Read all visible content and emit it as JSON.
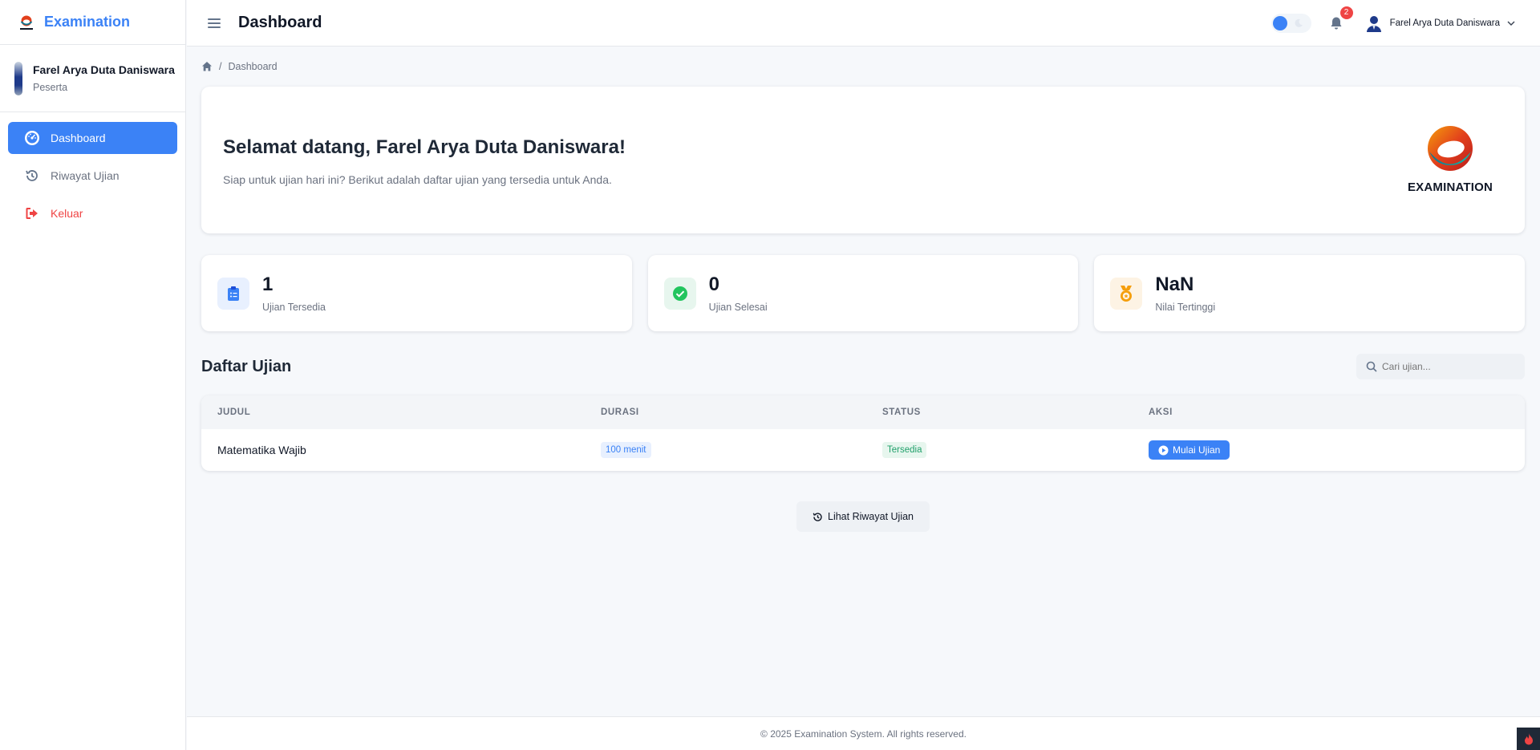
{
  "app": {
    "name": "Examination"
  },
  "user": {
    "name": "Farel Arya Duta Daniswara",
    "role": "Peserta"
  },
  "sidebar": {
    "items": [
      {
        "label": "Dashboard",
        "icon": "gauge-icon",
        "active": true
      },
      {
        "label": "Riwayat Ujian",
        "icon": "history-icon",
        "active": false
      },
      {
        "label": "Keluar",
        "icon": "logout-icon",
        "active": false
      }
    ]
  },
  "header": {
    "title": "Dashboard",
    "notifications": "2",
    "user_name": "Farel Arya Duta Daniswara"
  },
  "breadcrumb": {
    "current": "Dashboard",
    "separator": "/"
  },
  "welcome": {
    "title": "Selamat datang, Farel Arya Duta Daniswara!",
    "subtitle": "Siap untuk ujian hari ini? Berikut adalah daftar ujian yang tersedia untuk Anda.",
    "logo_text": "EXAMINATION"
  },
  "stats": [
    {
      "value": "1",
      "label": "Ujian Tersedia",
      "icon": "clipboard-list-icon",
      "color": "#3b82f6",
      "bg": "#e8f0fe"
    },
    {
      "value": "0",
      "label": "Ujian Selesai",
      "icon": "check-circle-icon",
      "color": "#22c55e",
      "bg": "#e7f6ee"
    },
    {
      "value": "NaN",
      "label": "Nilai Tertinggi",
      "icon": "medal-icon",
      "color": "#f59e0b",
      "bg": "#fdf3e4"
    }
  ],
  "exam_list": {
    "title": "Daftar Ujian",
    "search_placeholder": "Cari ujian...",
    "columns": [
      "JUDUL",
      "DURASI",
      "STATUS",
      "AKSI"
    ],
    "rows": [
      {
        "title": "Matematika Wajib",
        "duration": "100 menit",
        "status": "Tersedia",
        "action": "Mulai Ujian"
      }
    ]
  },
  "history_button": "Lihat Riwayat Ujian",
  "footer": "© 2025 Examination System. All rights reserved.",
  "colors": {
    "primary": "#3b82f6",
    "danger": "#ef4444",
    "success": "#22a06b"
  }
}
